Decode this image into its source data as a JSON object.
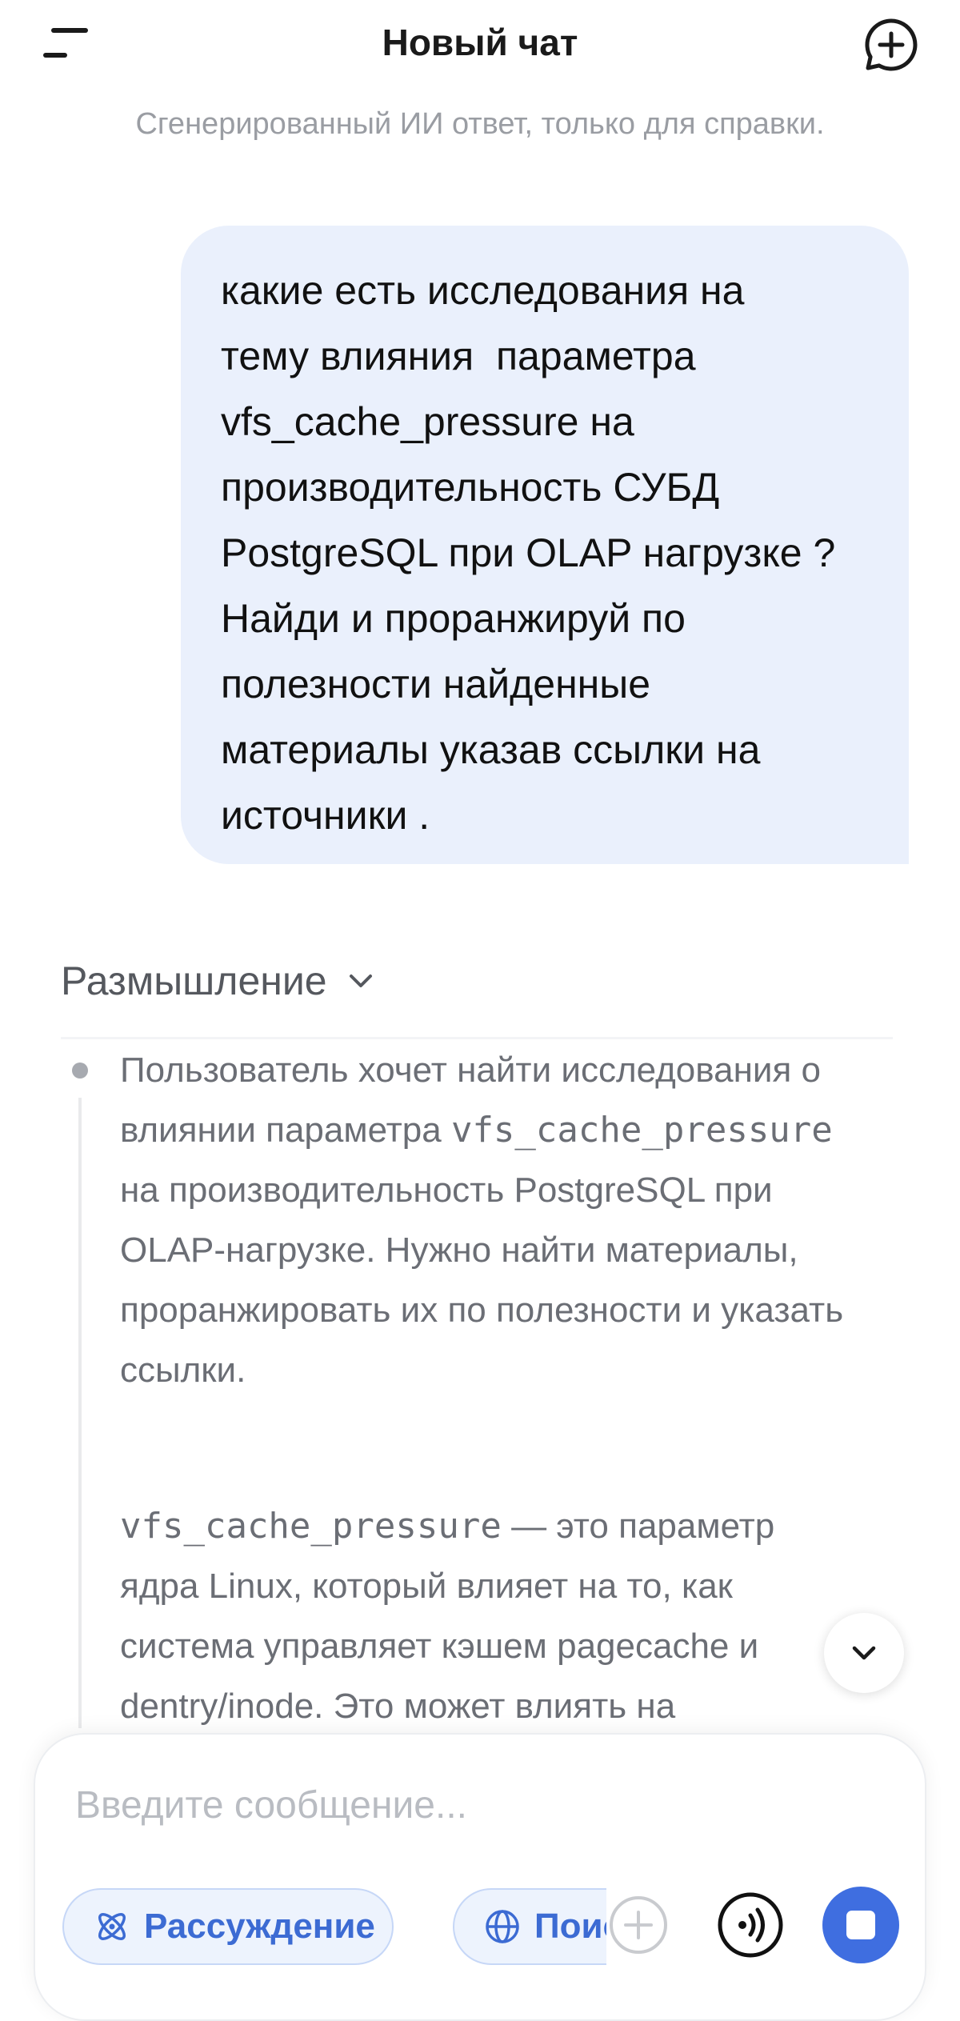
{
  "header": {
    "title": "Новый чат",
    "menu_icon": "menu-icon",
    "new_chat_icon": "plus-circle-icon"
  },
  "disclaimer": "Сгенерированный ИИ ответ, только для справки.",
  "user_message": "какие есть исследования на\nтему влияния  параметра\nvfs_cache_pressure на\nпроизводительность СУБД\nPostgreSQL при OLAP нагрузке ?\nНайди и проранжируй по\nполезности найденные\nматериалы указав ссылки на\nисточники .",
  "reasoning": {
    "label": "Размышление",
    "para1": "Пользователь хочет найти исследования о влиянии параметра",
    "para1_code": "vfs_cache_pressure",
    "para1_rest": "на производительность PostgreSQL при OLAP-нагрузке. Нужно найти материалы, проранжировать их по полезности и указать ссылки.",
    "para2_code": "vfs_cache_pressure",
    "para2_rest": "— это параметр ядра Linux, который влияет на то, как система управляет кэшем pagecache и dentry/inode. Это может влиять на"
  },
  "composer": {
    "placeholder": "Введите сообщение...",
    "chip_reasoning": "Рассуждение",
    "chip_search": "Поиск"
  },
  "colors": {
    "accent": "#3f6ee0",
    "bubble": "#eaf0fc",
    "chip_bg": "#edf3fd",
    "chip_text": "#3c6bd3"
  }
}
